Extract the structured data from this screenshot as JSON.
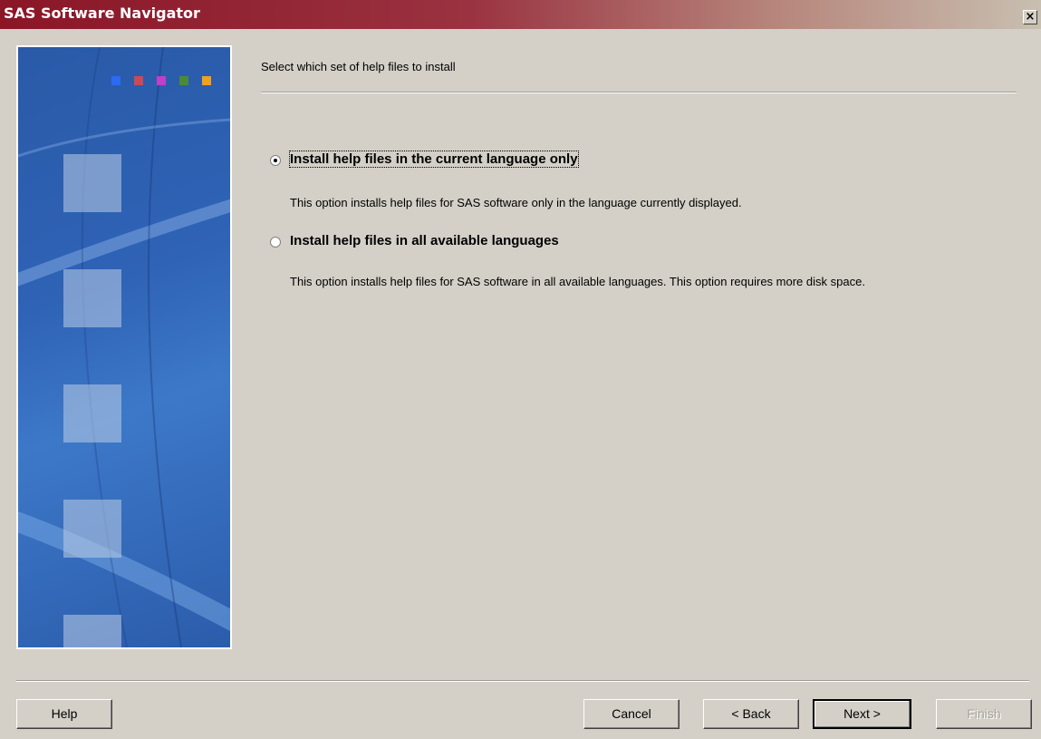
{
  "window": {
    "title": "SAS Software Navigator",
    "close_label": "×"
  },
  "side_panel": {
    "dot_colors": [
      "#2a6cf0",
      "#c84a5a",
      "#c040c8",
      "#4a8a3a",
      "#f0a020"
    ]
  },
  "main": {
    "header": "Select which set of help files to install",
    "options": [
      {
        "label": "Install help files in the current language only",
        "description": "This option installs help files for SAS software only in the language currently displayed.",
        "selected": true
      },
      {
        "label": "Install help files in all available languages",
        "description": "This option installs help files for SAS software in all available languages.  This option requires more disk space.",
        "selected": false
      }
    ]
  },
  "buttons": {
    "help": "Help",
    "cancel": "Cancel",
    "back": "< Back",
    "next": "Next >",
    "finish": "Finish"
  }
}
